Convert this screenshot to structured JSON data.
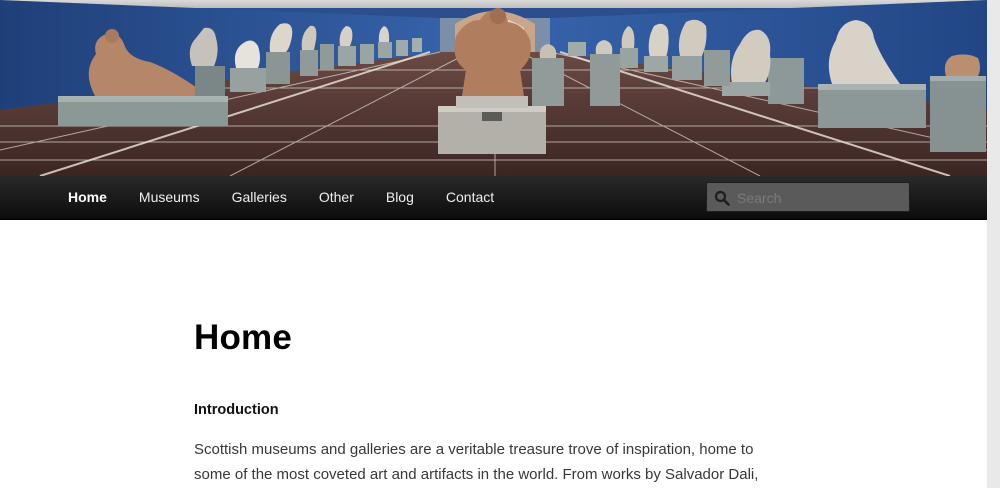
{
  "header_image": {
    "alt": ""
  },
  "nav": {
    "items": [
      {
        "label": "Home",
        "active": true
      },
      {
        "label": "Museums",
        "active": false
      },
      {
        "label": "Galleries",
        "active": false
      },
      {
        "label": "Other",
        "active": false
      },
      {
        "label": "Blog",
        "active": false
      },
      {
        "label": "Contact",
        "active": false
      }
    ]
  },
  "search": {
    "placeholder": "Search",
    "value": ""
  },
  "content": {
    "title": "Home",
    "section_heading": "Introduction",
    "intro_text": "Scottish museums and galleries are a veritable treasure trove of inspiration, home to some of the most coveted art and artifacts in the world. From works by Salvador Dali,"
  },
  "colors": {
    "nav_bg": "#1a1a1a",
    "hall_wall": "#2a4f8c",
    "hall_floor": "#4a2f2c",
    "title": "#000000",
    "body_text": "#373737"
  }
}
